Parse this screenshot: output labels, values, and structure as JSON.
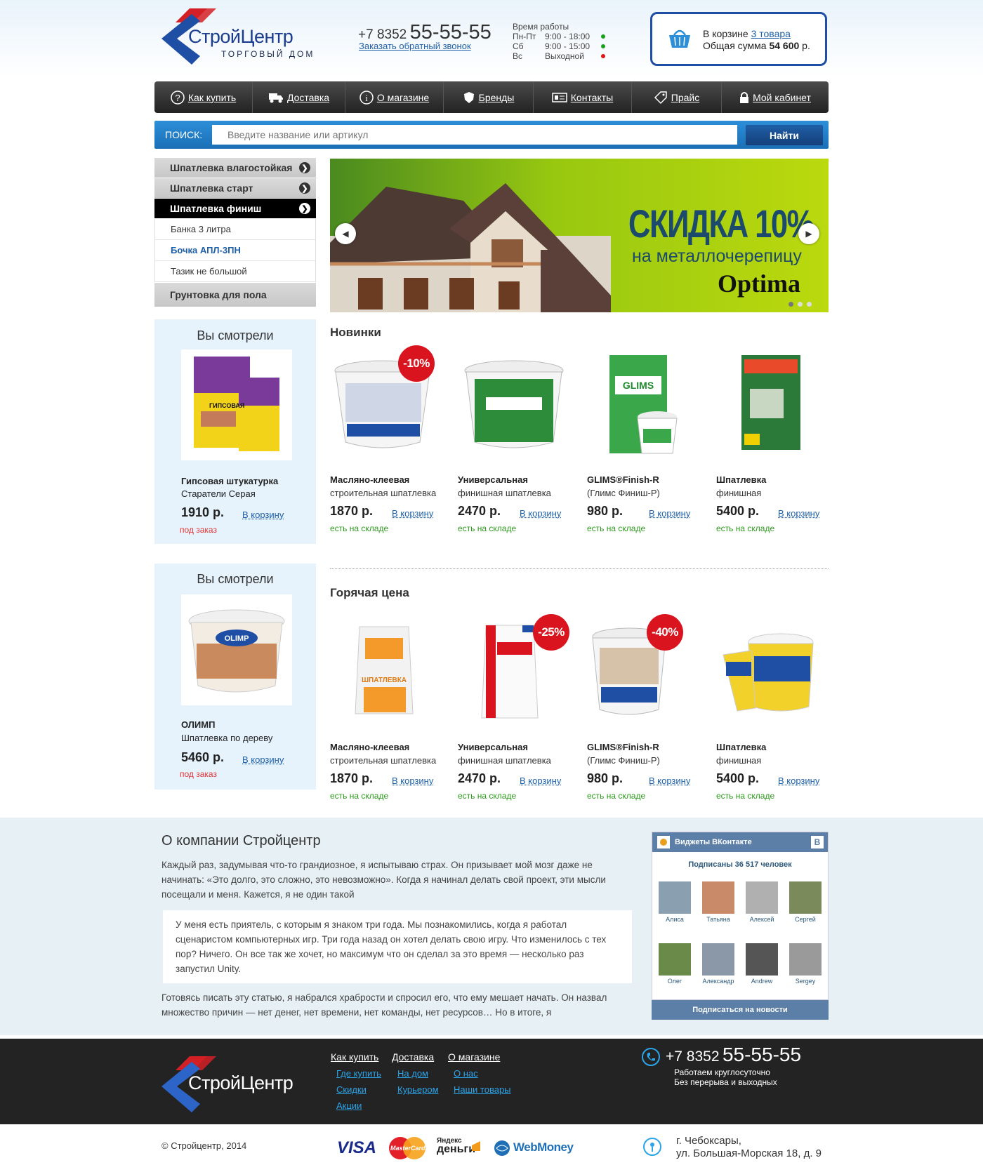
{
  "header": {
    "logo_title": "СтройЦентр",
    "logo_subtitle": "ТОРГОВЫЙ ДОМ",
    "phone_prefix": "+7 8352",
    "phone_number": "55-55-55",
    "callback_link": "Заказать обратный звонок",
    "hours_title": "Время работы",
    "hours": [
      {
        "day": "Пн-Пт",
        "time": "9:00 - 18:00",
        "status_color": "#19a01c"
      },
      {
        "day": "Сб",
        "time": "9:00 - 15:00",
        "status_color": "#19a01c"
      },
      {
        "day": "Вс",
        "time": "Выходной",
        "status_color": "#e01818"
      }
    ],
    "cart": {
      "label": "В корзине",
      "items_link": "3 товара",
      "total_label": "Общая сумма",
      "total_value": "54 600",
      "currency": "р."
    }
  },
  "nav": {
    "items": [
      {
        "label": "Как купить",
        "icon": "question-icon"
      },
      {
        "label": "Доставка",
        "icon": "truck-icon"
      },
      {
        "label": "О магазине",
        "icon": "info-icon"
      },
      {
        "label": "Бренды",
        "icon": "badge-icon"
      },
      {
        "label": "Контакты",
        "icon": "contacts-card-icon"
      },
      {
        "label": "Прайс",
        "icon": "tag-icon"
      },
      {
        "label": "Мой кабинет",
        "icon": "lock-icon"
      }
    ]
  },
  "search": {
    "label": "ПОИСК:",
    "placeholder": "Введите название или артикул",
    "button": "Найти"
  },
  "categories": {
    "items": [
      {
        "label": "Шпатлевка влагостойкая"
      },
      {
        "label": "Шпатлевка старт"
      },
      {
        "label": "Шпатлевка финиш"
      }
    ],
    "subitems": [
      {
        "label": "Банка 3 литра"
      },
      {
        "label": "Бочка АПЛ-3ПН"
      },
      {
        "label": "Тазик не большой"
      }
    ],
    "last": "Грунтовка для пола"
  },
  "banner": {
    "headline": "СКИДКА 10%",
    "subline": "на металлочерепицу",
    "brand": "Optima"
  },
  "viewed": [
    {
      "title": "Вы смотрели",
      "name": "Гипсовая штукатурка",
      "desc": "Старатели Серая",
      "price": "1910 р.",
      "button": "В корзину",
      "status": "под заказ"
    },
    {
      "title": "Вы смотрели",
      "name": "ОЛИМП",
      "desc": "Шпатлевка по дереву",
      "price": "5460 р.",
      "button": "В корзину",
      "status": "под заказ"
    }
  ],
  "sections": {
    "new_title": "Новинки",
    "hot_title": "Горячая цена"
  },
  "new_products": [
    {
      "name": "Масляно-клеевая",
      "desc": "строительная шпатлевка",
      "price": "1870 р.",
      "button": "В корзину",
      "status": "есть на складе",
      "badge": "-10%"
    },
    {
      "name": "Универсальная",
      "desc": "финишная шпатлевка",
      "price": "2470 р.",
      "button": "В корзину",
      "status": "есть на складе",
      "badge": ""
    },
    {
      "name": "GLIMS®Finish-R",
      "desc": "(Глимс Финиш-Р)",
      "price": "980 р.",
      "button": "В корзину",
      "status": "есть на складе",
      "badge": ""
    },
    {
      "name": "Шпатлевка",
      "desc": "финишная",
      "price": "5400 р.",
      "button": "В корзину",
      "status": "есть на складе",
      "badge": ""
    }
  ],
  "hot_products": [
    {
      "name": "Масляно-клеевая",
      "desc": "строительная шпатлевка",
      "price": "1870 р.",
      "button": "В корзину",
      "status": "есть на складе",
      "badge": ""
    },
    {
      "name": "Универсальная",
      "desc": "финишная шпатлевка",
      "price": "2470 р.",
      "button": "В корзину",
      "status": "есть на складе",
      "badge": "-25%"
    },
    {
      "name": "GLIMS®Finish-R",
      "desc": "(Глимс Финиш-Р)",
      "price": "980 р.",
      "button": "В корзину",
      "status": "есть на складе",
      "badge": "-40%"
    },
    {
      "name": "Шпатлевка",
      "desc": "финишная",
      "price": "5400 р.",
      "button": "В корзину",
      "status": "есть на складе",
      "badge": ""
    }
  ],
  "about": {
    "title": "О компании Стройцентр",
    "p1": "Каждый раз, задумывая что-то грандиозное, я испытываю страх. Он призывает мой мозг даже не начинать: «Это долго, это сложно, это невозможно». Когда я начинал делать свой проект, эти мысли посещали и меня. Кажется, я не один такой",
    "quote": "У меня есть приятель, с которым я знаком три года. Мы познакомились, когда я работал сценаристом компьютерных игр. Три года назад он хотел делать свою игру. Что изменилось с тех пор? Ничего. Он все так же хочет, но максимум что он сделал за это время — несколько раз запустил Unity.",
    "p2": "Готовясь писать эту статью, я набрался храбрости и спросил его, что ему мешает начать. Он назвал множество причин — нет денег, нет времени, нет команды, нет ресурсов… Но в итоге, я"
  },
  "vk": {
    "title": "Виджеты ВКонтакте",
    "letter": "В",
    "subscribers": "Подписаны 36 517 человек",
    "friends": [
      "Алиса",
      "Татьяна",
      "Алексей",
      "Сергей",
      "Олег",
      "Александр",
      "Andrew",
      "Sergey"
    ],
    "button": "Подписаться на новости"
  },
  "footer": {
    "logo_title": "СтройЦентр",
    "columns": [
      {
        "head": "Как купить",
        "links": [
          "Где купить",
          "Скидки",
          "Акции"
        ]
      },
      {
        "head": "Доставка",
        "links": [
          "На дом",
          "Курьером"
        ]
      },
      {
        "head": "О магазине",
        "links": [
          "О нас",
          "Наши товары"
        ]
      }
    ],
    "phone_prefix": "+7 8352",
    "phone_number": "55-55-55",
    "work1": "Работаем круглосуточно",
    "work2": "Без перерыва и выходных",
    "copyright": "© Стройцентр, 2014",
    "payments": {
      "visa": "VISA",
      "mastercard": "MasterCard",
      "yandex_top": "Яндекс",
      "yandex_bottom": "деньги",
      "webmoney": "WebMoney"
    },
    "city": "г. Чебоксары,",
    "street": "ул. Большая-Морская 18, д. 9"
  },
  "colors": {
    "brand": "#1f4ea5",
    "accent": "#2d8fd8",
    "sale": "#d9141e",
    "in_stock": "#2c9a1c",
    "on_order": "#e43232"
  }
}
